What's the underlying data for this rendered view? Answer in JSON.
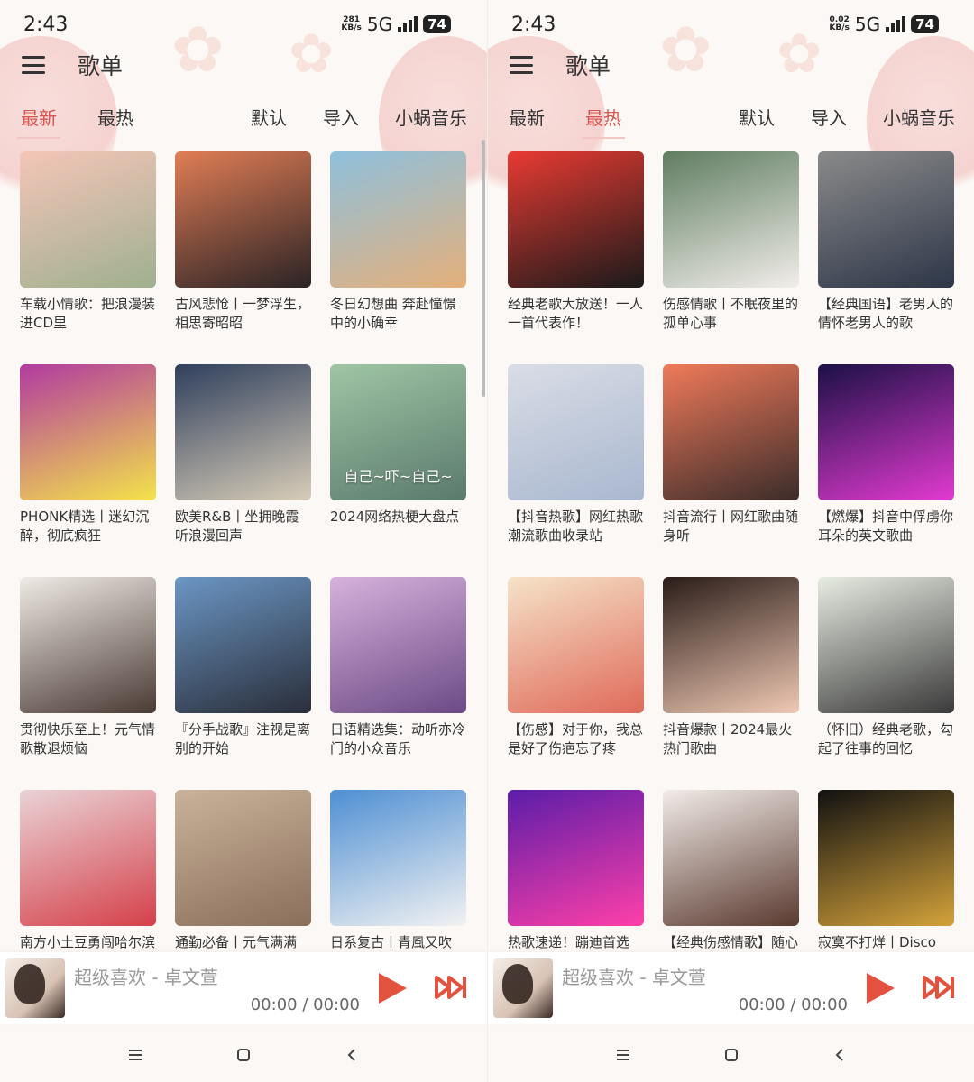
{
  "status_bar": [
    {
      "time": "2:43",
      "speed_top": "281",
      "speed_bottom": "KB/s",
      "network": "5G",
      "battery": "74"
    },
    {
      "time": "2:43",
      "speed_top": "0.02",
      "speed_bottom": "KB/s",
      "network": "5G",
      "battery": "74"
    }
  ],
  "app": {
    "title": "歌单"
  },
  "tabs": {
    "latest": "最新",
    "hottest": "最热",
    "default": "默认",
    "import": "导入",
    "source": "小蜗音乐"
  },
  "screens": [
    {
      "active_tab": "最新",
      "playlists": [
        {
          "title": "车载小情歌：把浪漫装进CD里",
          "colors": [
            "#f4c5b8",
            "#9fb08f"
          ]
        },
        {
          "title": "古风悲怆丨一梦浮生，相思寄昭昭",
          "colors": [
            "#e07d55",
            "#2b2325"
          ]
        },
        {
          "title": "冬日幻想曲 奔赴憧憬中的小确幸",
          "colors": [
            "#8ec0dd",
            "#e5b07b"
          ]
        },
        {
          "title": "PHONK精选丨迷幻沉醉，彻底疯狂",
          "colors": [
            "#b23aa0",
            "#f3e34a"
          ]
        },
        {
          "title": "欧美R&B丨坐拥晚霞听浪漫回声",
          "colors": [
            "#2f3f5d",
            "#d8cdb8"
          ]
        },
        {
          "title": "2024网络热梗大盘点",
          "colors": [
            "#9fc5a5",
            "#5a7a6c"
          ],
          "overlay": "自己~吓~自己~"
        },
        {
          "title": "贯彻快乐至上！元气情歌散退烦恼",
          "colors": [
            "#f0ebe6",
            "#4a3a34"
          ]
        },
        {
          "title": "『分手战歌』注视是离别的开始",
          "colors": [
            "#6b96c4",
            "#2a2e3a"
          ]
        },
        {
          "title": "日语精选集：动听亦冷门的小众音乐",
          "colors": [
            "#d6b2dc",
            "#6b4a86"
          ]
        },
        {
          "title": "南方小土豆勇闯哈尔滨",
          "colors": [
            "#e9d3d6",
            "#d5404a"
          ]
        },
        {
          "title": "通勤必备丨元气满满",
          "colors": [
            "#c9b29a",
            "#8a6f5b"
          ]
        },
        {
          "title": "日系复古丨青風又吹",
          "colors": [
            "#4e8fd3",
            "#f2f2f2"
          ]
        }
      ]
    },
    {
      "active_tab": "最热",
      "playlists": [
        {
          "title": "经典老歌大放送！一人一首代表作！",
          "colors": [
            "#e83a32",
            "#1a1a1a"
          ]
        },
        {
          "title": "伤感情歌丨不眠夜里的孤单心事",
          "colors": [
            "#5f7d61",
            "#f2eeea"
          ]
        },
        {
          "title": "【经典国语】老男人的情怀老男人的歌",
          "colors": [
            "#8a8a8a",
            "#2d3648"
          ]
        },
        {
          "title": "【抖音热歌】网红热歌潮流歌曲收录站",
          "colors": [
            "#d9dde6",
            "#a9b7cf"
          ]
        },
        {
          "title": "抖音流行丨网红歌曲随身听",
          "colors": [
            "#f07a5a",
            "#3b2c2a"
          ]
        },
        {
          "title": "【燃爆】抖音中俘虏你耳朵的英文歌曲",
          "colors": [
            "#1b1046",
            "#e23ad0"
          ]
        },
        {
          "title": "【伤感】对于你，我总是好了伤疤忘了疼",
          "colors": [
            "#f5e3c8",
            "#e06a5a"
          ]
        },
        {
          "title": "抖音爆款丨2024最火热门歌曲",
          "colors": [
            "#2a1c18",
            "#f0c9b4"
          ]
        },
        {
          "title": "（怀旧）经典老歌，勾起了往事的回忆",
          "colors": [
            "#e7ece2",
            "#3a3a3a"
          ]
        },
        {
          "title": "热歌速递！蹦迪首选",
          "colors": [
            "#5a1da8",
            "#ff3fa8"
          ]
        },
        {
          "title": "【经典伤感情歌】随心",
          "colors": [
            "#f2ece8",
            "#5a3a30"
          ]
        },
        {
          "title": "寂寞不打烊丨Disco",
          "colors": [
            "#111111",
            "#d4a23a"
          ]
        }
      ]
    }
  ],
  "player": {
    "song": "超级喜欢 - 卓文萱",
    "time": "00:00 / 00:00",
    "accent": "#e2523f"
  },
  "icons": {
    "menu": "menu-icon",
    "play": "play-icon",
    "next": "skip-next-icon",
    "recents": "recents-icon",
    "home": "home-icon",
    "back": "back-icon"
  }
}
